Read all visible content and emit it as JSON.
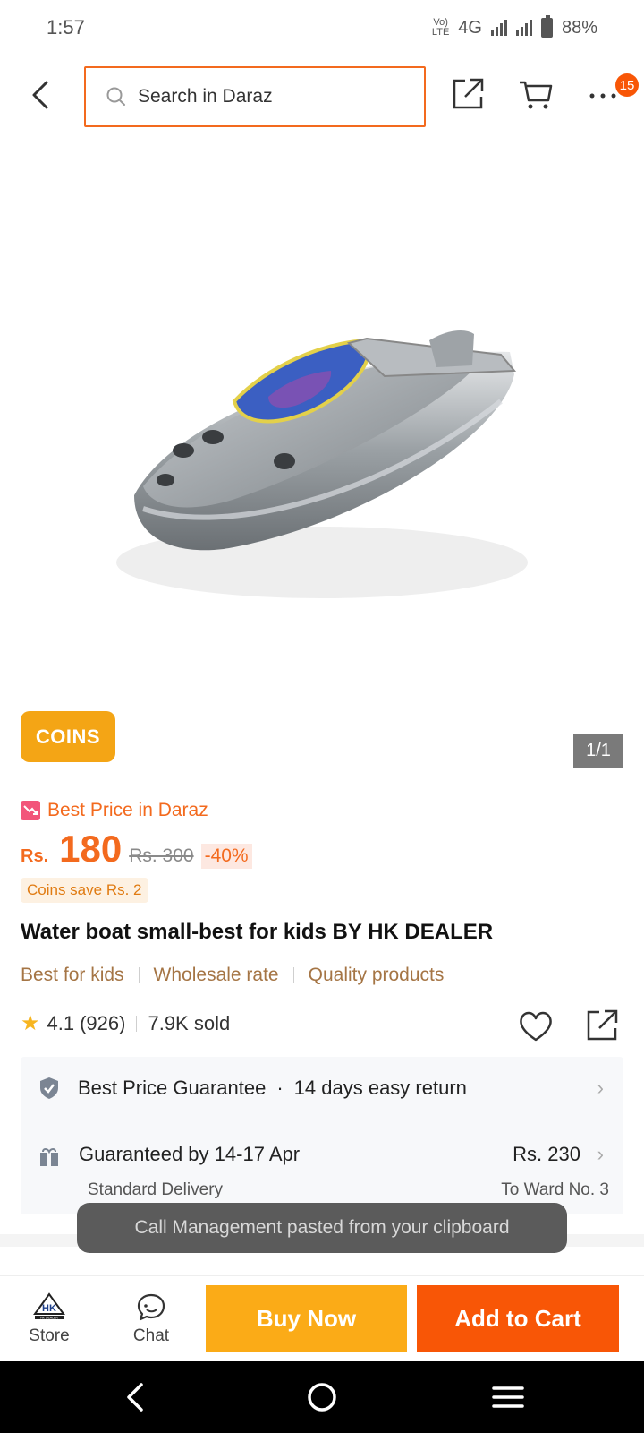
{
  "status_bar": {
    "time": "1:57",
    "network": "4G",
    "battery": "88%"
  },
  "header": {
    "search_placeholder": "Search in Daraz",
    "cart_badge": "15"
  },
  "gallery": {
    "coins_tag": "COINS",
    "counter": "1/1"
  },
  "price": {
    "best_price_label": "Best Price in Daraz",
    "currency": "Rs.",
    "current": "180",
    "original": "Rs. 300",
    "discount": "-40%",
    "coins_save": "Coins save Rs. 2"
  },
  "product": {
    "title": "Water boat small-best for kids BY HK DEALER",
    "tags": [
      "Best for kids",
      "Wholesale rate",
      "Quality products"
    ],
    "rating": "4.1",
    "reviews": "(926)",
    "sold": "7.9K sold"
  },
  "services": {
    "guarantee": "Best Price Guarantee",
    "return_policy": "14 days easy return",
    "delivery_title": "Guaranteed by 14-17 Apr",
    "delivery_price": "Rs. 230",
    "delivery_type": "Standard Delivery",
    "delivery_location": "To Ward No. 3"
  },
  "toast": "Call Management pasted from your clipboard",
  "bottom_bar": {
    "store_label": "Store",
    "store_logo_text": "HK DEALER",
    "chat_label": "Chat",
    "buy_now": "Buy Now",
    "add_to_cart": "Add to Cart"
  },
  "colors": {
    "brand_orange": "#f85606",
    "buy_now_yellow": "#fbab17",
    "coins_gold": "#f4a515",
    "tag_brown": "#a57545"
  },
  "icons": [
    "back-arrow-icon",
    "search-icon",
    "share-icon",
    "cart-icon",
    "more-icon",
    "heart-icon",
    "shield-check-icon",
    "gift-icon",
    "chevron-right-icon",
    "store-icon",
    "chat-icon",
    "nav-back-icon",
    "nav-home-icon",
    "nav-menu-icon"
  ]
}
